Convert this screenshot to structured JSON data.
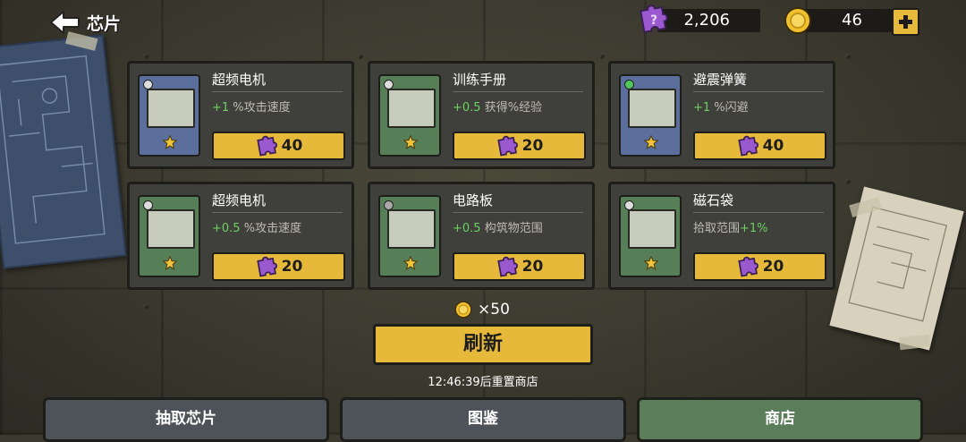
{
  "header": {
    "title": "芯片",
    "chip_count": "2,206",
    "coin_count": "46"
  },
  "items": [
    {
      "name": "超频电机",
      "bonus": "+1",
      "desc": " %攻击速度",
      "price": "40",
      "frame": "blue",
      "icon": "motor-icon"
    },
    {
      "name": "训练手册",
      "bonus": "+0.5",
      "desc": " 获得%经验",
      "price": "20",
      "frame": "green",
      "icon": "book-icon"
    },
    {
      "name": "避震弹簧",
      "bonus": "+1",
      "desc": " %闪避",
      "price": "40",
      "frame": "blue",
      "icon": "spring-icon"
    },
    {
      "name": "超频电机",
      "bonus": "+0.5",
      "desc": " %攻击速度",
      "price": "20",
      "frame": "green",
      "icon": "motor-icon"
    },
    {
      "name": "电路板",
      "bonus": "+0.5",
      "desc": " 构筑物范围",
      "price": "20",
      "frame": "green",
      "icon": "circuit-board-icon"
    },
    {
      "name": "磁石袋",
      "desc_prefix": "拾取范围",
      "bonus_suffix": "+1%",
      "price": "20",
      "frame": "green",
      "icon": "magnet-bag-icon"
    }
  ],
  "refresh": {
    "cost_prefix": "×",
    "cost": "50",
    "label": "刷新",
    "timer_text": "12:46:39后重置商店"
  },
  "tabs": [
    {
      "label": "抽取芯片",
      "active": false
    },
    {
      "label": "图鉴",
      "active": false
    },
    {
      "label": "商店",
      "active": true
    }
  ],
  "colors": {
    "accent_gold": "#e6b93b",
    "bonus_green": "#6bd160",
    "chip_purple": "#9b59d0"
  }
}
